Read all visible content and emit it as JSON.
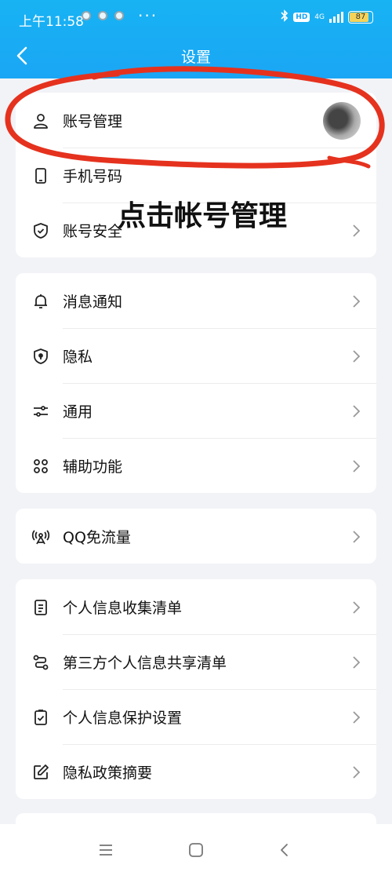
{
  "status_bar": {
    "time": "上午11:58",
    "more": "···",
    "network": "4G",
    "hd": "HD",
    "battery": "87",
    "battery_level": 0.87
  },
  "header": {
    "title": "设置",
    "back_icon": "chevron-left-icon"
  },
  "overlay": {
    "text": "点击帐号管理"
  },
  "colors": {
    "header": "#1aa6f5",
    "annotation": "#e5321e",
    "battery": "#f5d35a"
  },
  "groups": [
    {
      "items": [
        {
          "label": "账号管理",
          "icon": "user-icon",
          "trailing": "avatar"
        },
        {
          "label": "手机号码",
          "icon": "phone-icon",
          "trailing": "none"
        },
        {
          "label": "账号安全",
          "icon": "shield-check-icon",
          "trailing": "chevron"
        }
      ]
    },
    {
      "items": [
        {
          "label": "消息通知",
          "icon": "bell-icon",
          "trailing": "chevron"
        },
        {
          "label": "隐私",
          "icon": "privacy-shield-icon",
          "trailing": "chevron"
        },
        {
          "label": "通用",
          "icon": "sliders-icon",
          "trailing": "chevron"
        },
        {
          "label": "辅助功能",
          "icon": "grid-icon",
          "trailing": "chevron"
        }
      ]
    },
    {
      "items": [
        {
          "label": "QQ免流量",
          "icon": "signal-tower-icon",
          "trailing": "chevron"
        }
      ]
    },
    {
      "items": [
        {
          "label": "个人信息收集清单",
          "icon": "document-icon",
          "trailing": "chevron"
        },
        {
          "label": "第三方个人信息共享清单",
          "icon": "share-flow-icon",
          "trailing": "chevron"
        },
        {
          "label": "个人信息保护设置",
          "icon": "checklist-icon",
          "trailing": "chevron"
        },
        {
          "label": "隐私政策摘要",
          "icon": "edit-icon",
          "trailing": "chevron"
        }
      ]
    }
  ],
  "nav": {
    "items": [
      "menu-icon",
      "home-icon",
      "back-icon"
    ]
  }
}
